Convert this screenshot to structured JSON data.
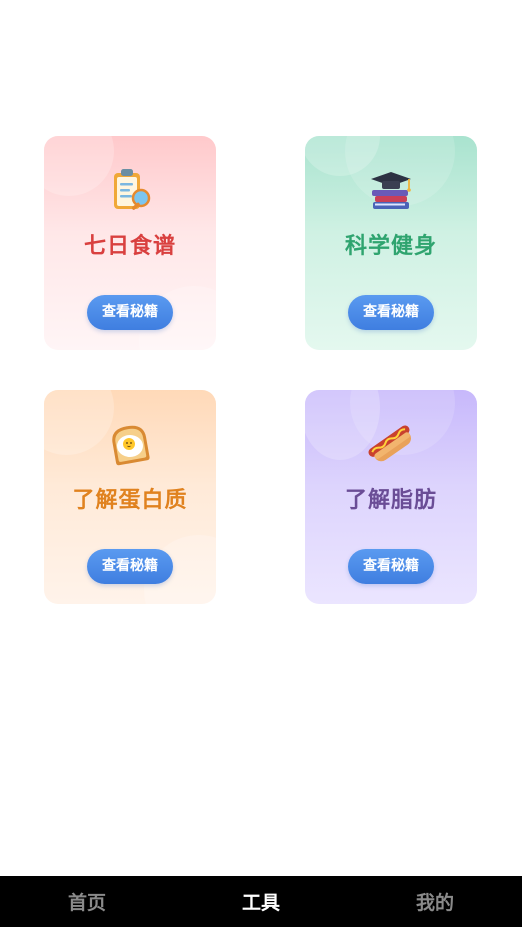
{
  "colors": {
    "recipe_title": "#d9403f",
    "fitness_title": "#2fa46f",
    "protein_title": "#e0821f",
    "fat_title": "#6a4d96",
    "button_bg": "#4a88e8",
    "nav_bg": "#000000",
    "nav_active": "#ffffff",
    "nav_inactive": "#8a8a8a"
  },
  "cards": [
    {
      "title": "七日食谱",
      "button_label": "查看秘籍",
      "icon": "clipboard-icon"
    },
    {
      "title": "科学健身",
      "button_label": "查看秘籍",
      "icon": "books-graduation-cap-icon"
    },
    {
      "title": "了解蛋白质",
      "button_label": "查看秘籍",
      "icon": "egg-toast-icon"
    },
    {
      "title": "了解脂肪",
      "button_label": "查看秘籍",
      "icon": "hotdog-icon"
    }
  ],
  "nav": {
    "items": [
      {
        "label": "首页",
        "active": false
      },
      {
        "label": "工具",
        "active": true
      },
      {
        "label": "我的",
        "active": false
      }
    ]
  }
}
